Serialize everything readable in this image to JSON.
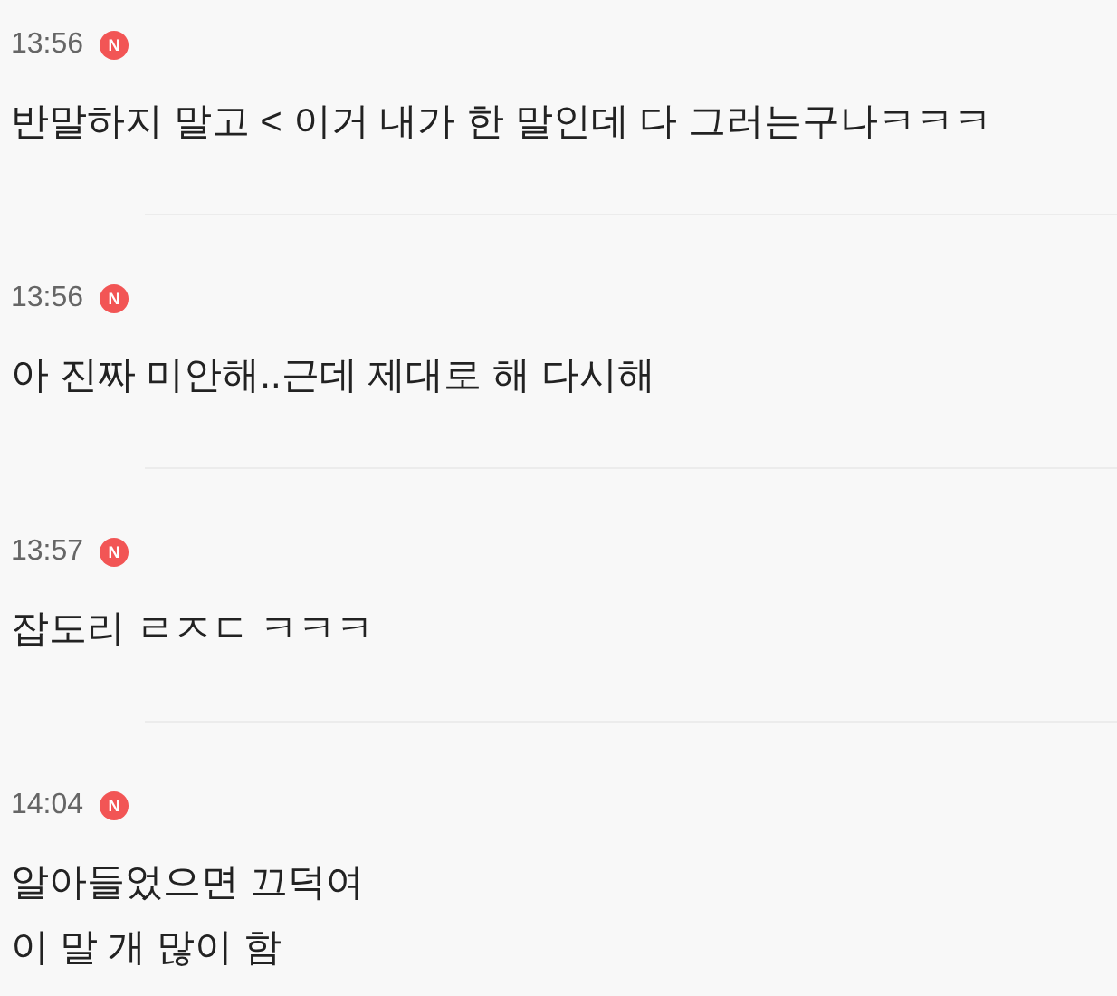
{
  "messages": [
    {
      "time": "13:56",
      "badge": "N",
      "text": "반말하지 말고 < 이거 내가 한 말인데 다 그러는구나ㅋㅋㅋ"
    },
    {
      "time": "13:56",
      "badge": "N",
      "text": "아 진짜 미안해..근데 제대로 해 다시해"
    },
    {
      "time": "13:57",
      "badge": "N",
      "text": "잡도리 ㄹㅈㄷ ㅋㅋㅋ"
    },
    {
      "time": "14:04",
      "badge": "N",
      "text": "알아들었으면 끄덕여\n이 말 개 많이 함"
    }
  ]
}
